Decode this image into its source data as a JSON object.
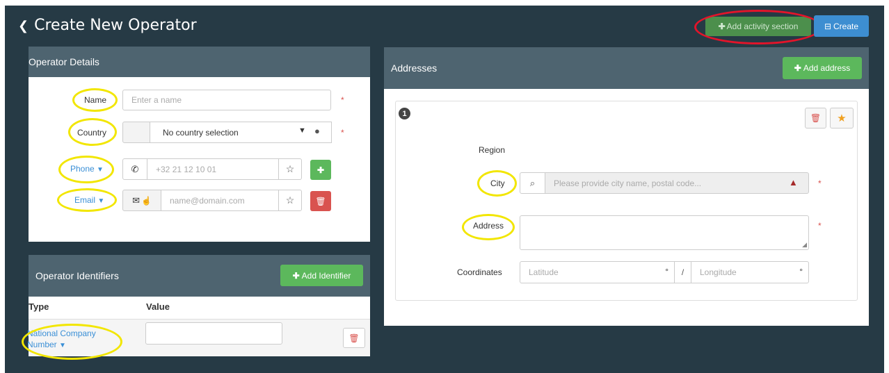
{
  "header": {
    "title": "Create New Operator",
    "add_activity_label": "Add activity section",
    "create_label": "Create"
  },
  "operator_details": {
    "heading": "Operator Details",
    "name_label": "Name",
    "name_placeholder": "Enter a name",
    "country_label": "Country",
    "country_value": "No country selection",
    "phone_label": "Phone",
    "phone_placeholder": "+32 21 12 10 01",
    "email_label": "Email",
    "email_placeholder": "name@domain.com",
    "required_mark": "*"
  },
  "identifiers": {
    "heading": "Operator Identifiers",
    "add_label": "Add Identifier",
    "col_type": "Type",
    "col_value": "Value",
    "row_type_line1": "National Company",
    "row_type_line2": "Number"
  },
  "addresses": {
    "heading": "Addresses",
    "add_label": "Add address",
    "index": "1",
    "region_label": "Region",
    "city_label": "City",
    "city_placeholder": "Please provide city name, postal code...",
    "address_label": "Address",
    "coordinates_label": "Coordinates",
    "latitude_placeholder": "Latitude",
    "longitude_placeholder": "Longitude",
    "degree": "°",
    "slash": "/"
  },
  "colors": {
    "background": "#263a45",
    "panel_header": "#4e6470",
    "green": "#5cb85c",
    "blue": "#3d8ed1",
    "danger": "#d9534f",
    "highlight_yellow": "#f2e600",
    "highlight_red": "#e3142a"
  }
}
